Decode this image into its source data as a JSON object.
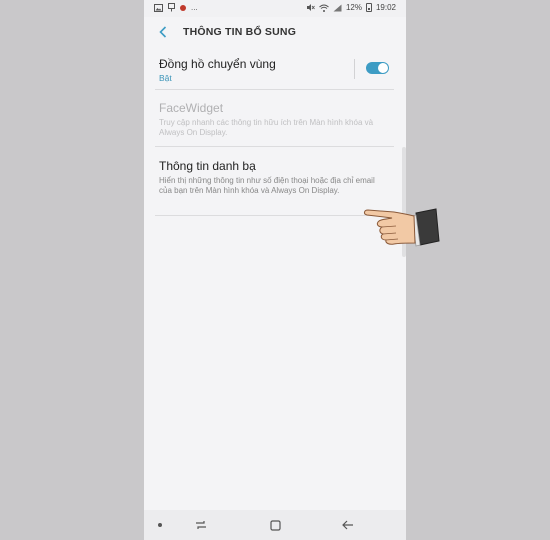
{
  "status_bar": {
    "left_icons": [
      "image-icon",
      "download-icon",
      "record-dot-icon"
    ],
    "left_more": "...",
    "right_icons": [
      "mute-icon",
      "wifi-icon",
      "signal-icon"
    ],
    "battery_percent": "12%",
    "time": "19:02"
  },
  "header": {
    "back_icon": "chevron-left-icon",
    "title": "THÔNG TIN BỔ SUNG"
  },
  "settings": {
    "items": [
      {
        "title": "Đồng hồ chuyển vùng",
        "subtitle": "Bật",
        "toggle_on": true,
        "enabled": true
      },
      {
        "title": "FaceWidget",
        "subtitle": "Truy cập nhanh các thông tin hữu ích trên Màn hình khóa và Always On Display.",
        "enabled": false
      },
      {
        "title": "Thông tin danh bạ",
        "subtitle": "Hiển thị những thông tin như số điện thoại hoặc địa chỉ email của bạn trên Màn hình khóa và Always On Display.",
        "enabled": true
      }
    ]
  },
  "nav_bar": {
    "icons": [
      "dot-icon",
      "recent-apps-icon",
      "home-icon",
      "back-arrow-icon"
    ]
  },
  "colors": {
    "accent": "#3d9cc4",
    "background": "#f4f4f6",
    "outer": "#c9c8ca"
  }
}
